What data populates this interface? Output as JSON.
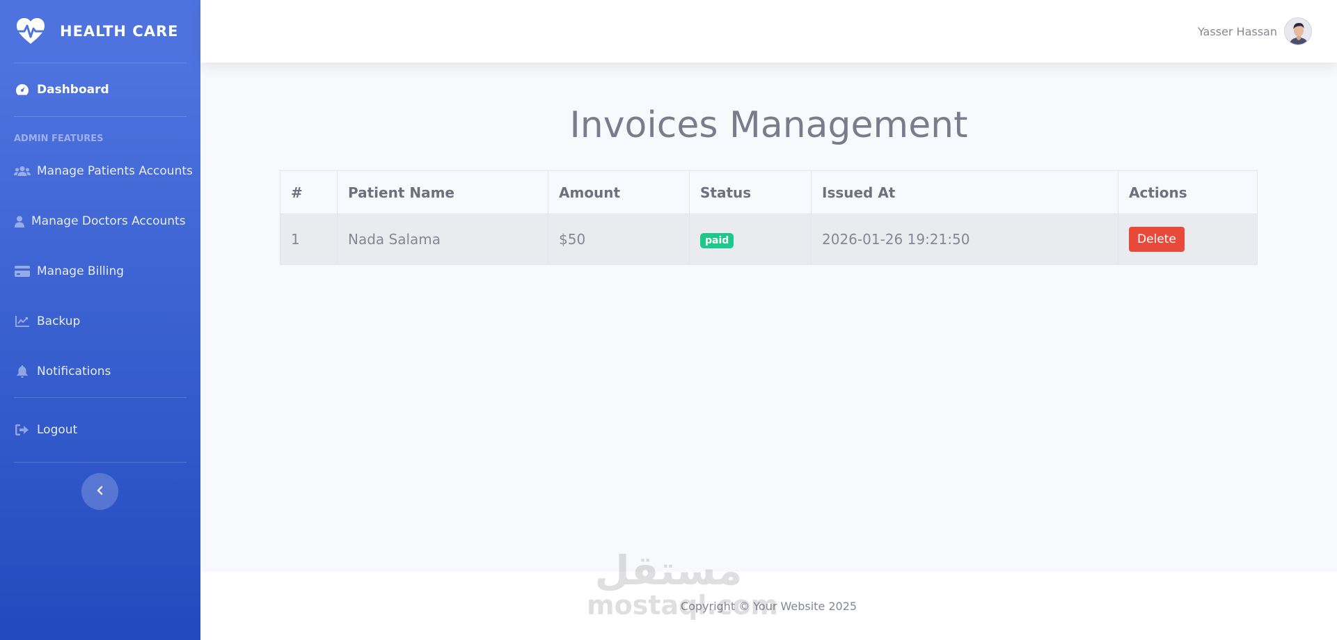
{
  "brand": {
    "name": "HEALTH CARE",
    "icon": "heart-pulse-icon"
  },
  "sidebar": {
    "dashboard": {
      "label": "Dashboard",
      "icon": "gauge-icon"
    },
    "heading": "ADMIN FEATURES",
    "items": [
      {
        "label": "Manage Patients Accounts",
        "icon": "users-icon"
      },
      {
        "label": "Manage Doctors Accounts",
        "icon": "user-icon"
      },
      {
        "label": "Manage Billing",
        "icon": "credit-card-icon"
      },
      {
        "label": "Backup",
        "icon": "chart-line-icon"
      },
      {
        "label": "Notifications",
        "icon": "bell-icon"
      }
    ],
    "logout": {
      "label": "Logout",
      "icon": "sign-out-icon"
    },
    "toggle_icon": "chevron-left-icon"
  },
  "topbar": {
    "user_name": "Yasser Hassan",
    "avatar_icon": "user-avatar"
  },
  "page": {
    "title": "Invoices Management"
  },
  "table": {
    "headers": [
      "#",
      "Patient Name",
      "Amount",
      "Status",
      "Issued At",
      "Actions"
    ],
    "rows": [
      {
        "id": "1",
        "patient_name": "Nada Salama",
        "amount": "$50",
        "status": "paid",
        "issued_at": "2026-01-26 19:21:50",
        "action_label": "Delete"
      }
    ]
  },
  "footer": {
    "text": "Copyright © Your Website 2025"
  },
  "watermark": {
    "arabic": "مستقل",
    "latin": "mostaql.com"
  },
  "colors": {
    "sidebar_top": "#4e73df",
    "sidebar_bottom": "#224abe",
    "success": "#1cc88a",
    "danger": "#e74a3b"
  }
}
